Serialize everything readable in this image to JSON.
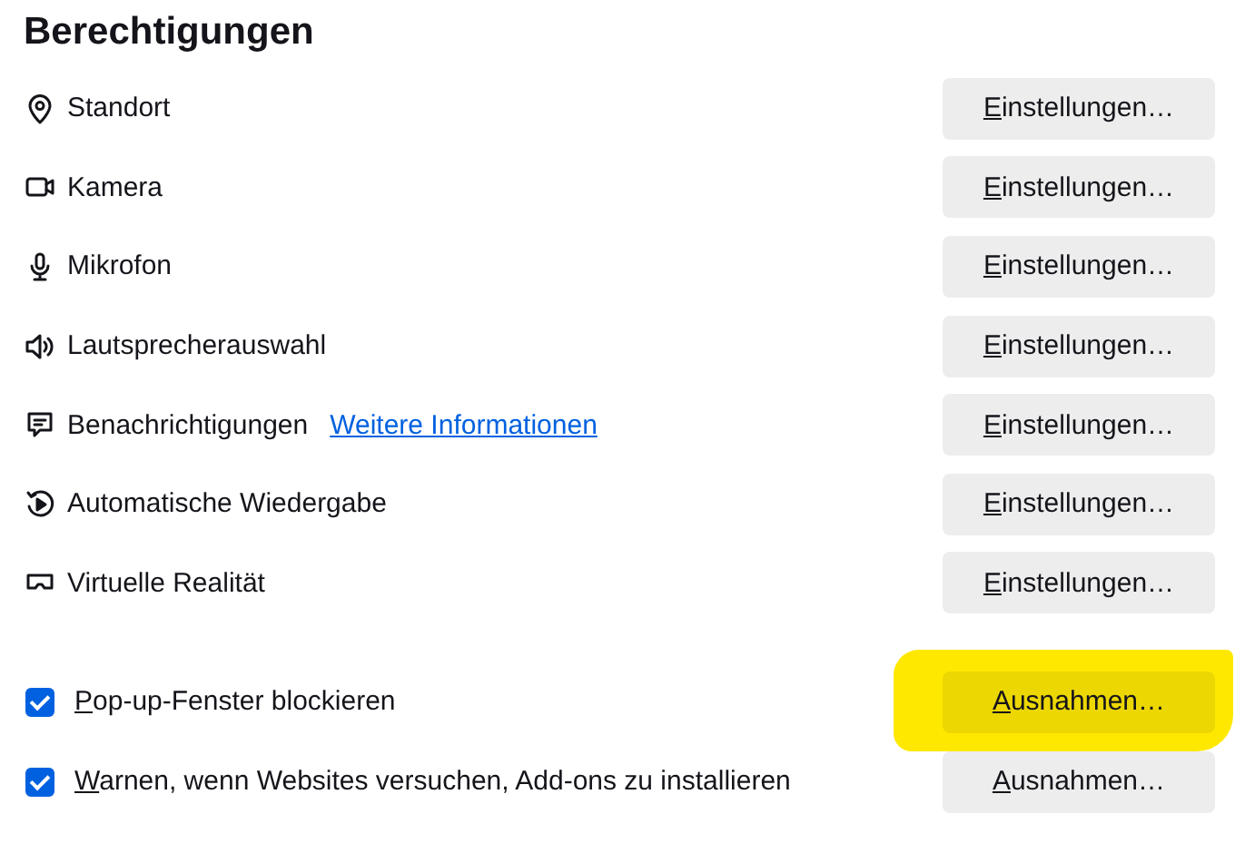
{
  "heading": "Berechtigungen",
  "permissions": [
    {
      "label": "Standort",
      "button": {
        "label": "Einstellungen…",
        "underline_first": true
      }
    },
    {
      "label": "Kamera",
      "button": {
        "label": "Einstellungen…",
        "underline_first": true
      }
    },
    {
      "label": "Mikrofon",
      "button": {
        "label": "Einstellungen…",
        "underline_first": true
      }
    },
    {
      "label": "Lautsprecherauswahl",
      "button": {
        "label": "Einstellungen…",
        "underline_first": true
      }
    },
    {
      "label": "Benachrichtigungen",
      "link": "Weitere Informationen",
      "button": {
        "label": "Einstellungen…",
        "underline_first": true
      }
    },
    {
      "label": "Automatische Wiedergabe",
      "button": {
        "label": "Einstellungen…",
        "underline_first": true
      }
    },
    {
      "label": "Virtuelle Realität",
      "button": {
        "label": "Einstellungen…",
        "underline_first": true
      }
    }
  ],
  "options": [
    {
      "label": "Pop-up-Fenster blockieren",
      "underline_first": true,
      "checked": true,
      "button": {
        "label": "Ausnahmen…",
        "underline_first": true
      },
      "highlighted": true
    },
    {
      "label": "Warnen, wenn Websites versuchen, Add-ons zu installieren",
      "underline_first": true,
      "checked": true,
      "button": {
        "label": "Ausnahmen…",
        "underline_first": true
      },
      "highlighted": false
    }
  ]
}
